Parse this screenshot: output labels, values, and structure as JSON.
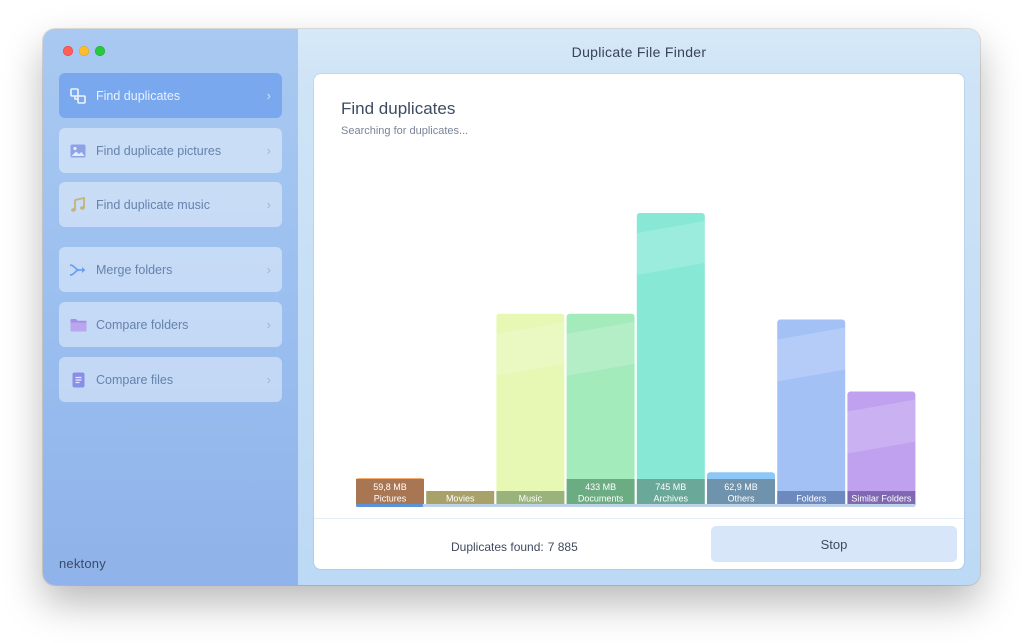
{
  "app": {
    "window_title": "Duplicate File Finder",
    "brand": "nektony"
  },
  "colors": {
    "sidebar_active": "#7aa8ee",
    "panel_background": "#ffffff",
    "stop_button": "#d7e6f8"
  },
  "sidebar": {
    "items": [
      {
        "label": "Find duplicates",
        "icon": "duplicates-icon",
        "active": true
      },
      {
        "label": "Find duplicate pictures",
        "icon": "picture-icon",
        "active": false
      },
      {
        "label": "Find duplicate music",
        "icon": "music-note-icon",
        "active": false
      },
      {
        "label": "Merge folders",
        "icon": "merge-icon",
        "active": false
      },
      {
        "label": "Compare folders",
        "icon": "folder-icon",
        "active": false
      },
      {
        "label": "Compare files",
        "icon": "document-icon",
        "active": false
      }
    ]
  },
  "main": {
    "title": "Find duplicates",
    "status": "Searching for duplicates...",
    "progress": 0.12
  },
  "footer": {
    "duplicates_label": "Duplicates found:",
    "duplicates_count": "7 885",
    "stop_label": "Stop"
  },
  "chart_data": {
    "type": "bar",
    "categories": [
      "Pictures",
      "Movies",
      "Music",
      "Documents",
      "Archives",
      "Others",
      "Folders",
      "Similar Folders"
    ],
    "value_labels": [
      "59,8 MB",
      "",
      "",
      "433 MB",
      "745 MB",
      "62,9 MB",
      "",
      ""
    ],
    "levels": [
      0.08,
      0.0,
      0.65,
      0.65,
      1.0,
      0.1,
      0.63,
      0.38
    ],
    "colors": [
      "#f2ae70",
      "#c9b26b",
      "#e6f8b4",
      "#a4ebbb",
      "#86e8d5",
      "#8cc7f5",
      "#a4c1f6",
      "#bfa1f0"
    ],
    "label_colors": [
      "#a97654",
      "#a8a26a",
      "#9ab27b",
      "#6cac82",
      "#6aa89a",
      "#6f93ac",
      "#6d8abf",
      "#8069b2"
    ]
  }
}
